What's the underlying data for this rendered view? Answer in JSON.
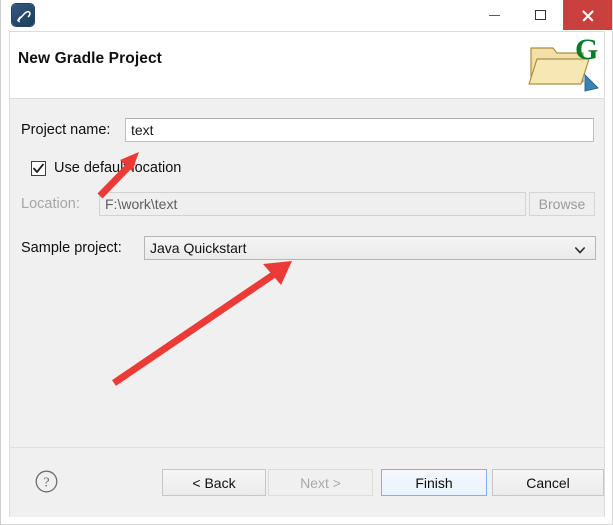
{
  "window": {
    "app_icon": "gradle-app-icon",
    "controls": {
      "minimize": "minimize-icon",
      "maximize": "maximize-icon",
      "close": "close-icon"
    },
    "close_color": "#c9403f"
  },
  "wizard": {
    "title": "New Gradle Project",
    "banner_icon": "gradle-folder-icon"
  },
  "form": {
    "project_name": {
      "label": "Project name:",
      "value": "text",
      "placeholder": ""
    },
    "use_default_location": {
      "label": "Use default location",
      "checked": true
    },
    "location": {
      "label": "Location:",
      "value": "F:\\work\\text",
      "enabled": false
    },
    "browse": {
      "label": "Browse",
      "enabled": false
    },
    "sample_project": {
      "label": "Sample project:",
      "value": "Java Quickstart",
      "arrow_icon": "chevron-down-icon"
    }
  },
  "footer": {
    "help": "help-icon",
    "back": "< Back",
    "next": "Next >",
    "finish": "Finish",
    "cancel": "Cancel"
  },
  "annotations": {
    "arrow_color": "#ec3a36",
    "arrow_project_name": "arrow pointing to project name field",
    "arrow_sample_project": "arrow pointing to sample project dropdown"
  }
}
